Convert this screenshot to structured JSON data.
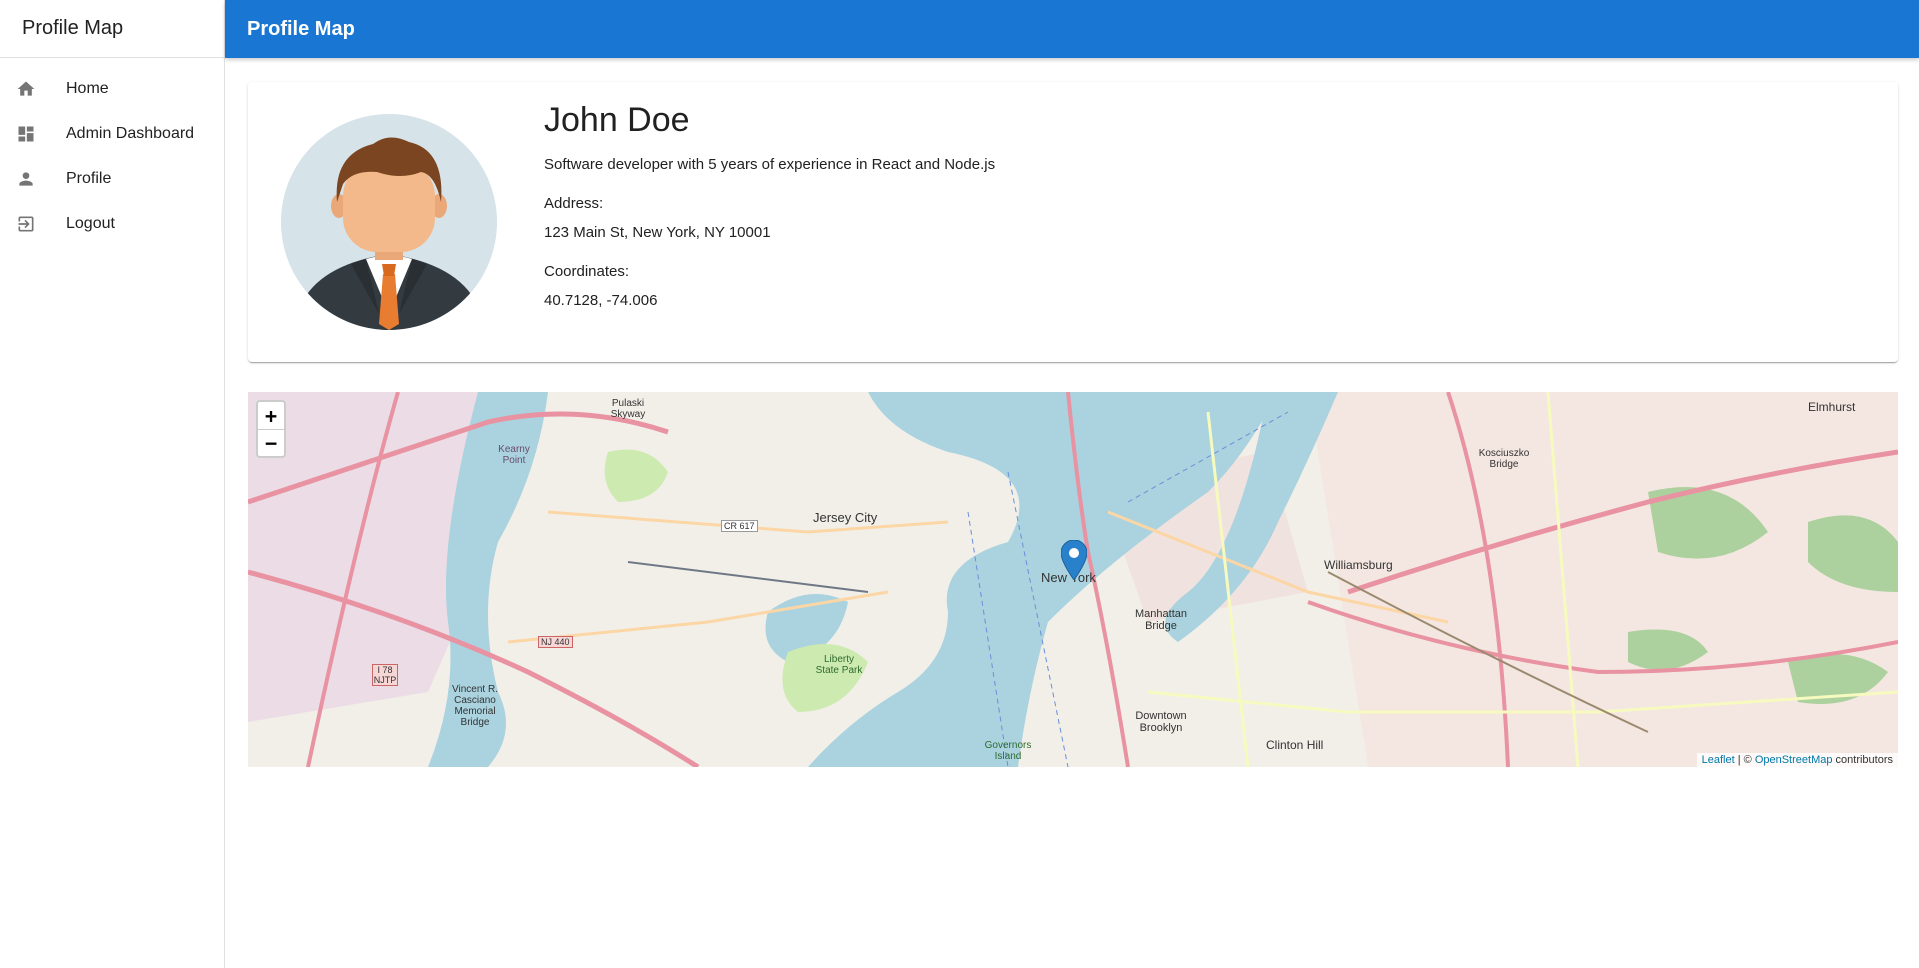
{
  "sidebar": {
    "brand": "Profile Map",
    "items": [
      {
        "label": "Home",
        "icon": "home-icon"
      },
      {
        "label": "Admin Dashboard",
        "icon": "dashboard-icon"
      },
      {
        "label": "Profile",
        "icon": "person-icon"
      },
      {
        "label": "Logout",
        "icon": "logout-icon"
      }
    ]
  },
  "appbar": {
    "title": "Profile Map"
  },
  "profile": {
    "name": "John Doe",
    "bio": "Software developer with 5 years of experience in React and Node.js",
    "address_label": "Address:",
    "address": "123 Main St, New York, NY 10001",
    "coordinates_label": "Coordinates:",
    "coordinates": "40.7128, -74.006"
  },
  "map": {
    "zoom_in": "+",
    "zoom_out": "−",
    "attribution_leaflet": "Leaflet",
    "attribution_sep": " | © ",
    "attribution_osm": "OpenStreetMap",
    "attribution_suffix": " contributors",
    "labels": {
      "new_york": "New York",
      "jersey_city": "Jersey City",
      "williamsburg": "Williamsburg",
      "manhattan_bridge": "Manhattan Bridge",
      "downtown_brooklyn": "Downtown Brooklyn",
      "clinton_hill": "Clinton Hill",
      "elmhurst": "Elmhurst",
      "liberty_state_park": "Liberty State Park",
      "kearny_point": "Kearny Point",
      "vincent_bridge": "Vincent R. Casciano Memorial Bridge",
      "governors_island": "Governors Island",
      "kosciuszko_bridge": "Kosciuszko Bridge",
      "pulaski_skyway": "Pulaski Skyway",
      "cr617": "CR 617",
      "nj440": "NJ 440",
      "i78": "I 78 NJTP"
    }
  },
  "colors": {
    "primary": "#1976d2",
    "water": "#aad3df",
    "land": "#f2efe9",
    "marker": "#2a81cb"
  }
}
